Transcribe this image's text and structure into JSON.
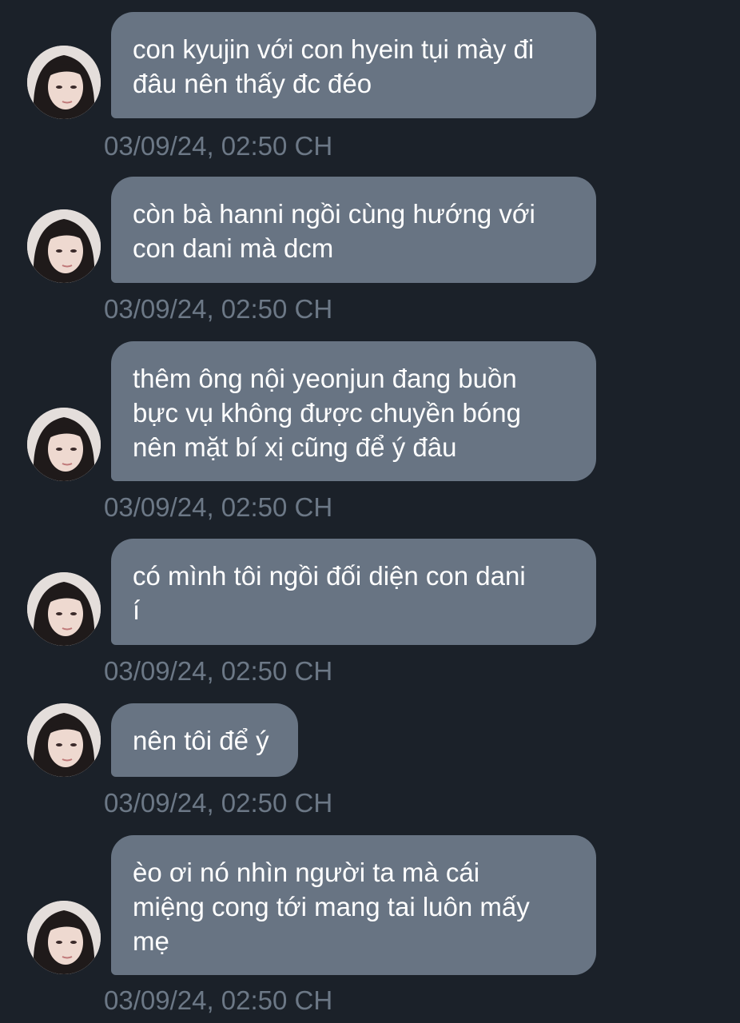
{
  "colors": {
    "background": "#1b2129",
    "bubble": "#687483",
    "bubble_text": "#ffffff",
    "timestamp": "#6c7886"
  },
  "avatar_icon": "profile-photo",
  "messages": [
    {
      "text": "con kyujin với con hyein tụi mày đi\nđâu nên thấy đc đéo",
      "time": "03/09/24, 02:50 CH"
    },
    {
      "text": "còn bà hanni ngồi cùng hướng với\ncon dani mà dcm",
      "time": "03/09/24, 02:50 CH"
    },
    {
      "text": "thêm ông nội yeonjun đang buồn\nbực vụ không được chuyền bóng\nnên mặt bí xị cũng để ý đâu",
      "time": "03/09/24, 02:50 CH"
    },
    {
      "text": "có mình tôi ngồi đối diện con dani\ní",
      "time": "03/09/24, 02:50 CH"
    },
    {
      "text": "nên tôi để ý",
      "time": "03/09/24, 02:50 CH"
    },
    {
      "text": "èo ơi nó nhìn người ta mà cái\nmiệng cong tới mang tai luôn mấy\nmẹ",
      "time": "03/09/24, 02:50 CH"
    }
  ]
}
